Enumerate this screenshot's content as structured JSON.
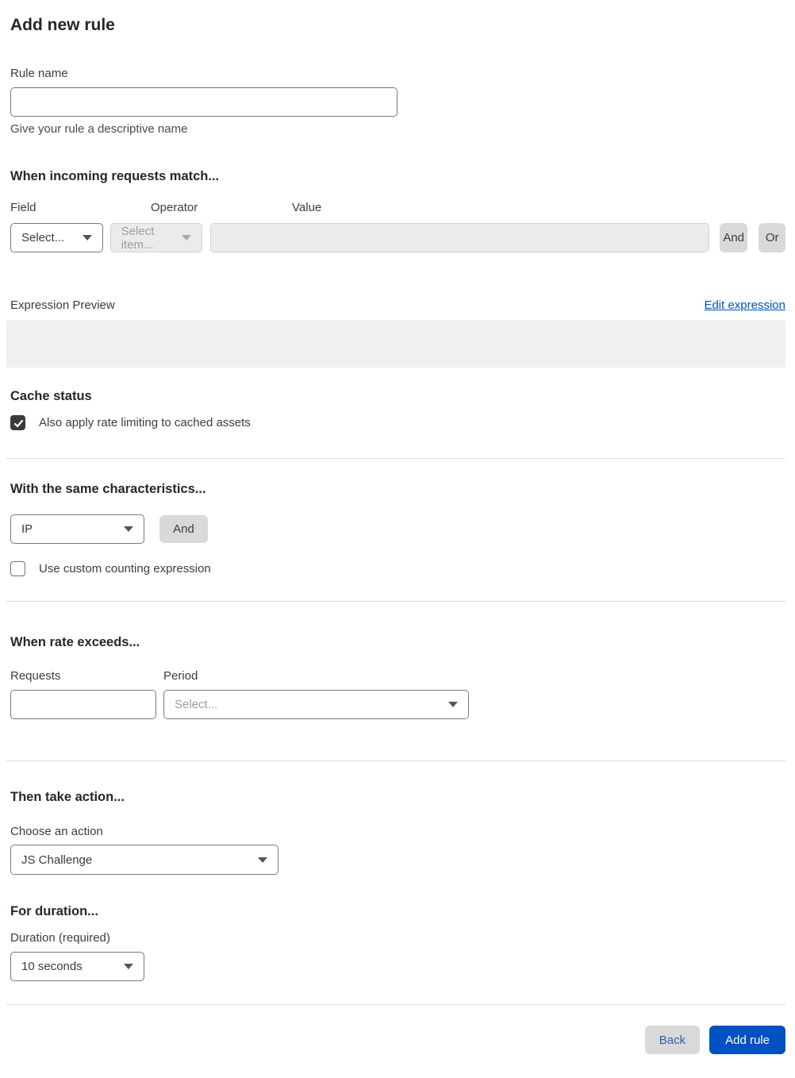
{
  "header": {
    "title": "Add new rule"
  },
  "rule_name": {
    "label": "Rule name",
    "value": "",
    "help": "Give your rule a descriptive name"
  },
  "match": {
    "heading": "When incoming requests match...",
    "field_label": "Field",
    "field_value": "Select...",
    "operator_label": "Operator",
    "operator_value": "Select item...",
    "operator_disabled": true,
    "value_label": "Value",
    "value_value": "",
    "value_disabled": true,
    "and_label": "And",
    "or_label": "Or"
  },
  "preview": {
    "label": "Expression Preview",
    "edit_link": "Edit expression",
    "content": ""
  },
  "cache": {
    "heading": "Cache status",
    "checkbox_label": "Also apply rate limiting to cached assets",
    "checked": true
  },
  "characteristics": {
    "heading": "With the same characteristics...",
    "key_value": "IP",
    "and_label": "And",
    "checkbox_label": "Use custom counting expression",
    "checked": false
  },
  "rate": {
    "heading": "When rate exceeds...",
    "requests_label": "Requests",
    "requests_value": "",
    "period_label": "Period",
    "period_value": "Select..."
  },
  "action": {
    "heading": "Then take action...",
    "label": "Choose an action",
    "value": "JS Challenge"
  },
  "duration": {
    "heading": "For duration...",
    "label": "Duration (required)",
    "value": "10 seconds"
  },
  "footer": {
    "back_label": "Back",
    "add_rule_label": "Add rule"
  },
  "colors": {
    "accent_blue": "#0051c3",
    "link_blue": "#0051c3",
    "disabled_bg": "#ebebeb",
    "gray_button": "#d9d9d9",
    "checkbox_dark": "#3b3b3b",
    "divider": "#dcdcdc",
    "preview_bg": "#f0f0f0"
  }
}
